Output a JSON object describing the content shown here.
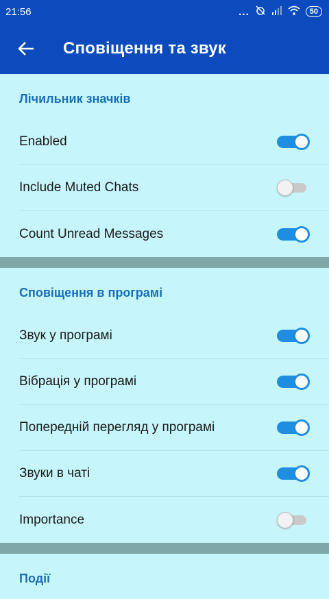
{
  "statusbar": {
    "time": "21:56",
    "dots": "...",
    "battery": "50"
  },
  "header": {
    "title": "Сповіщення та звук"
  },
  "sections": [
    {
      "title": "Лічильник значків",
      "items": [
        {
          "label": "Enabled",
          "on": true
        },
        {
          "label": "Include Muted Chats",
          "on": false
        },
        {
          "label": "Count Unread Messages",
          "on": true
        }
      ]
    },
    {
      "title": "Сповіщення в програмі",
      "items": [
        {
          "label": "Звук у програмі",
          "on": true
        },
        {
          "label": "Вібрація у програмі",
          "on": true
        },
        {
          "label": "Попередній перегляд у програмі",
          "on": true
        },
        {
          "label": "Звуки в чаті",
          "on": true
        },
        {
          "label": "Importance",
          "on": false
        }
      ]
    },
    {
      "title": "Події",
      "items": []
    }
  ],
  "colors": {
    "appbar": "#0b4bbd",
    "background": "#c6f6fb",
    "accent": "#1f8ee0",
    "section_title": "#1a6eb8"
  }
}
